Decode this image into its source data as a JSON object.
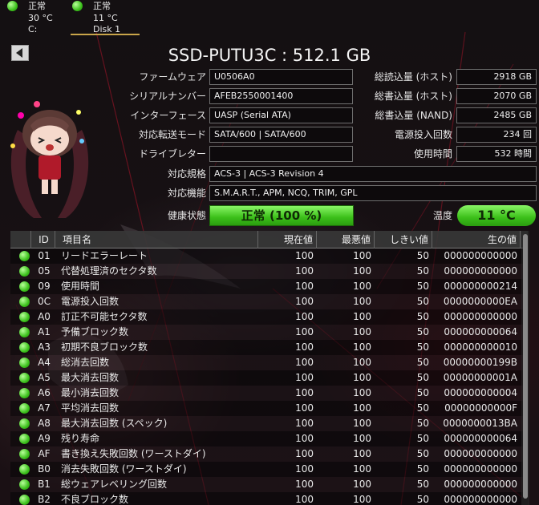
{
  "drives": [
    {
      "status": "正常",
      "temp": "30 °C",
      "letter": "C:"
    },
    {
      "status": "正常",
      "temp": "11 °C",
      "letter": "Disk 1"
    }
  ],
  "model_title": "SSD-PUTU3C : 512.1 GB",
  "info_left": {
    "firmware_label": "ファームウェア",
    "firmware": "U0506A0",
    "serial_label": "シリアルナンバー",
    "serial": "AFEB2550001400",
    "interface_label": "インターフェース",
    "interface": "UASP (Serial ATA)",
    "transfer_label": "対応転送モード",
    "transfer": "SATA/600 | SATA/600",
    "drive_letter_label": "ドライブレター",
    "drive_letter": "",
    "standard_label": "対応規格",
    "standard": "ACS-3 | ACS-3 Revision 4",
    "features_label": "対応機能",
    "features": "S.M.A.R.T., APM, NCQ, TRIM, GPL"
  },
  "info_right": {
    "host_reads_label": "総読込量 (ホスト)",
    "host_reads": "2918 GB",
    "host_writes_label": "総書込量 (ホスト)",
    "host_writes": "2070 GB",
    "nand_writes_label": "総書込量 (NAND)",
    "nand_writes": "2485 GB",
    "power_count_label": "電源投入回数",
    "power_count": "234 回",
    "power_hours_label": "使用時間",
    "power_hours": "532 時間"
  },
  "health": {
    "label": "健康状態",
    "value": "正常 (100 %)",
    "color": "#3bbf19"
  },
  "temperature": {
    "label": "温度",
    "value": "11 °C"
  },
  "smart": {
    "headers": {
      "id": "ID",
      "name": "項目名",
      "current": "現在値",
      "worst": "最悪値",
      "threshold": "しきい値",
      "raw": "生の値"
    },
    "rows": [
      {
        "id": "01",
        "name": "リードエラーレート",
        "current": "100",
        "worst": "100",
        "threshold": "50",
        "raw": "000000000000"
      },
      {
        "id": "05",
        "name": "代替処理済のセクタ数",
        "current": "100",
        "worst": "100",
        "threshold": "50",
        "raw": "000000000000"
      },
      {
        "id": "09",
        "name": "使用時間",
        "current": "100",
        "worst": "100",
        "threshold": "50",
        "raw": "000000000214"
      },
      {
        "id": "0C",
        "name": "電源投入回数",
        "current": "100",
        "worst": "100",
        "threshold": "50",
        "raw": "0000000000EA"
      },
      {
        "id": "A0",
        "name": "訂正不可能セクタ数",
        "current": "100",
        "worst": "100",
        "threshold": "50",
        "raw": "000000000000"
      },
      {
        "id": "A1",
        "name": "予備ブロック数",
        "current": "100",
        "worst": "100",
        "threshold": "50",
        "raw": "000000000064"
      },
      {
        "id": "A3",
        "name": "初期不良ブロック数",
        "current": "100",
        "worst": "100",
        "threshold": "50",
        "raw": "000000000010"
      },
      {
        "id": "A4",
        "name": "総消去回数",
        "current": "100",
        "worst": "100",
        "threshold": "50",
        "raw": "00000000199B"
      },
      {
        "id": "A5",
        "name": "最大消去回数",
        "current": "100",
        "worst": "100",
        "threshold": "50",
        "raw": "00000000001A"
      },
      {
        "id": "A6",
        "name": "最小消去回数",
        "current": "100",
        "worst": "100",
        "threshold": "50",
        "raw": "000000000004"
      },
      {
        "id": "A7",
        "name": "平均消去回数",
        "current": "100",
        "worst": "100",
        "threshold": "50",
        "raw": "00000000000F"
      },
      {
        "id": "A8",
        "name": "最大消去回数 (スペック)",
        "current": "100",
        "worst": "100",
        "threshold": "50",
        "raw": "0000000013BA"
      },
      {
        "id": "A9",
        "name": "残り寿命",
        "current": "100",
        "worst": "100",
        "threshold": "50",
        "raw": "000000000064"
      },
      {
        "id": "AF",
        "name": "書き換え失敗回数 (ワーストダイ)",
        "current": "100",
        "worst": "100",
        "threshold": "50",
        "raw": "000000000000"
      },
      {
        "id": "B0",
        "name": "消去失敗回数 (ワーストダイ)",
        "current": "100",
        "worst": "100",
        "threshold": "50",
        "raw": "000000000000"
      },
      {
        "id": "B1",
        "name": "総ウェアレベリング回数",
        "current": "100",
        "worst": "100",
        "threshold": "50",
        "raw": "000000000000"
      },
      {
        "id": "B2",
        "name": "不良ブロック数",
        "current": "100",
        "worst": "100",
        "threshold": "50",
        "raw": "000000000000"
      }
    ]
  },
  "icons": {
    "status_ok": "green-dot-icon",
    "back": "back-arrow-icon",
    "mascot": "anime-mascot-image"
  },
  "colors": {
    "ok_green": "#3bbf19",
    "background": "#120b0e"
  }
}
